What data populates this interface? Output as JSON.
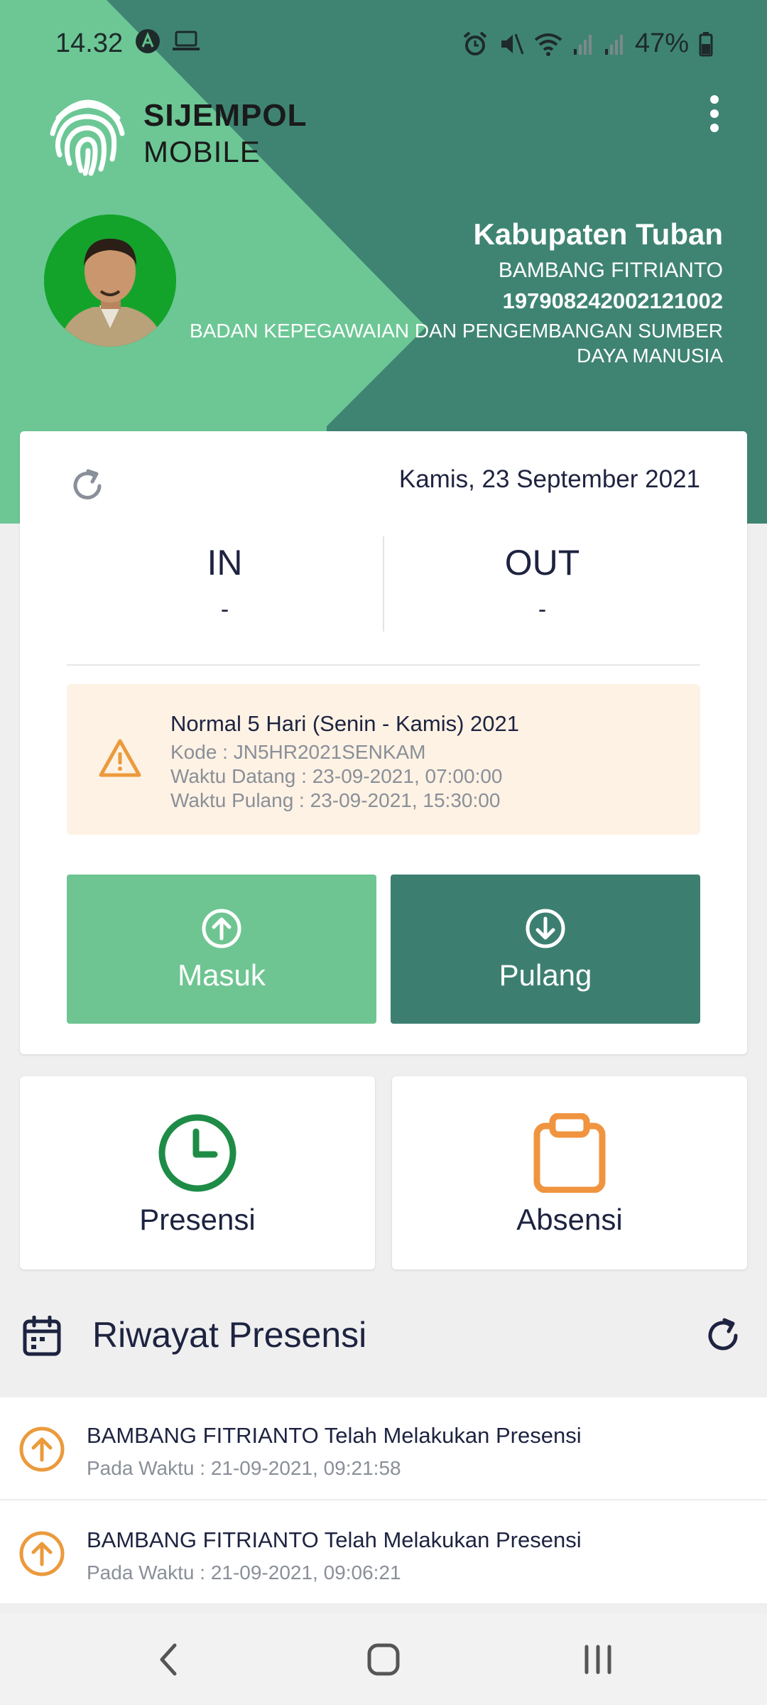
{
  "status_bar": {
    "time": "14.32",
    "battery": "47%"
  },
  "app": {
    "logo_title": "SIJEMPOL",
    "logo_subtitle": "MOBILE"
  },
  "profile": {
    "region": "Kabupaten Tuban",
    "name": "BAMBANG FITRIANTO",
    "nip": "197908242002121002",
    "unit": "BADAN KEPEGAWAIAN DAN PENGEMBANGAN SUMBER DAYA MANUSIA"
  },
  "attendance": {
    "date": "Kamis, 23 September 2021",
    "in_label": "IN",
    "in_value": "-",
    "out_label": "OUT",
    "out_value": "-"
  },
  "schedule": {
    "title": "Normal 5 Hari (Senin - Kamis) 2021",
    "code": "Kode : JN5HR2021SENKAM",
    "arrive": "Waktu Datang : 23-09-2021, 07:00:00",
    "leave": "Waktu Pulang : 23-09-2021, 15:30:00"
  },
  "buttons": {
    "masuk": "Masuk",
    "pulang": "Pulang"
  },
  "tiles": {
    "presensi": "Presensi",
    "absensi": "Absensi"
  },
  "riwayat": {
    "title": "Riwayat Presensi",
    "items": [
      {
        "text": "BAMBANG FITRIANTO Telah Melakukan Presensi",
        "time": "Pada Waktu : 21-09-2021, 09:21:58"
      },
      {
        "text": "BAMBANG FITRIANTO Telah Melakukan Presensi",
        "time": "Pada Waktu : 21-09-2021, 09:06:21"
      }
    ]
  },
  "colors": {
    "header_dark": "#3f8472",
    "header_light": "#6cc795",
    "masuk": "#6ec592",
    "pulang": "#3c7f70",
    "presensi_icon": "#1e8c46",
    "absensi_icon": "#f0943f",
    "warning": "#eb9a3c"
  },
  "icons": {
    "refresh": "refresh-icon",
    "warning": "warning-icon",
    "arrow_up": "arrow-up-circle-icon",
    "arrow_down": "arrow-down-circle-icon",
    "clock": "clock-icon",
    "clipboard": "clipboard-icon",
    "calendar": "calendar-icon"
  }
}
